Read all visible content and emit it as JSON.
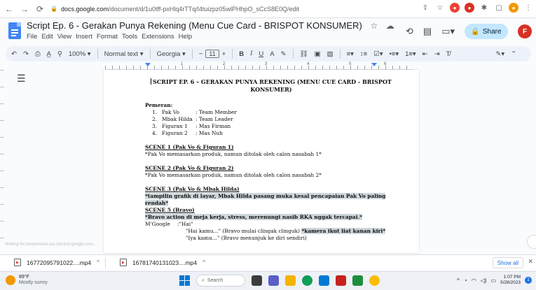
{
  "browser": {
    "url_host": "docs.google.com",
    "url_path": "/document/d/1u0tff-pxHlq4rTTq/l4tuizpz05wlPHhpO_sCcS8E0Q/edit",
    "nav": {
      "back": "←",
      "forward": "→",
      "reload": "⟳",
      "lock": "🔒"
    }
  },
  "doc_header": {
    "title": "Script Ep. 6 - Gerakan Punya Rekening (Menu Cue Card - BRISPOT KONSUMER)",
    "menus": [
      "File",
      "Edit",
      "View",
      "Insert",
      "Format",
      "Tools",
      "Extensions",
      "Help"
    ],
    "share_label": "Share",
    "avatar_letter": "F"
  },
  "toolbar": {
    "zoom": "100%",
    "style": "Normal text",
    "font": "Georgia",
    "font_size": "11",
    "bold": "B",
    "italic": "I",
    "underline": "U",
    "text_color": "A"
  },
  "document": {
    "heading": "SCRIPT EP. 6 – GERAKAN PUNYA REKENING (MENU CUE CARD - BRISPOT KONSUMER)",
    "cast_label": "Pemeran:",
    "cast": [
      {
        "num": "1.",
        "name": "Pak Vo",
        "role": ": Team Member"
      },
      {
        "num": "2.",
        "name": "Mbak Hilda",
        "role": ": Team Leader"
      },
      {
        "num": "3.",
        "name": "Figuran 1",
        "role": ": Mas Firman"
      },
      {
        "num": "4.",
        "name": "Figuran 2",
        "role": ": Mas Nuh"
      }
    ],
    "scene1_title": "SCENE 1 (Pak Vo & Figuran 1)",
    "scene1_text": "*Pak Vo memasarkan produk, namun ditolak oleh calon nasabah 1*",
    "scene2_title": "SCENE 2 (Pak Vo & Figuran 2)",
    "scene2_text": "*Pak Vo memasarkan produk, namun ditolak oleh calon nasabah 2*",
    "scene3_title": "SCENE 3 (Pak Vo & Mbak Hilda)",
    "scene3_text": "*tampilin grafik di layar, Mbak Hilda pasang muka kesal pencapaian Pak Vo paling rendah*",
    "scene5_title": "SCENE 5 (Bravo)",
    "scene5_text": "*Bravo action di meja kerja, stress, merenungi nasib RKA nggak tercapai.*",
    "dialog_speaker": "M'Google",
    "dialog_1": ":\"Hai\"",
    "dialog_2_a": "\"Hai kamu...\" (Bravo mulai clingak clinguk)",
    "dialog_2_b": "*kamera ikut liat kanan kiri*",
    "dialog_3": "\"Iya kamu...\" (Bravo menunjuk ke diri sendiri)"
  },
  "status_hint": "Waiting for peoplestack-pa.clients6.google.com...",
  "downloads": [
    {
      "name": "16772095791022....mp4"
    },
    {
      "name": "16781740131023....mp4"
    }
  ],
  "download_show_all": "Show all",
  "taskbar": {
    "temp": "89°F",
    "weather": "Mostly sunny",
    "search_placeholder": "Search",
    "time": "1:07 PM",
    "date": "5/28/2023",
    "notification_count": "1"
  },
  "colors": {
    "share_bg": "#c2e7ff",
    "docs_blue": "#4285f4",
    "highlight": "#cfd8dc",
    "avatar": "#d93025"
  }
}
